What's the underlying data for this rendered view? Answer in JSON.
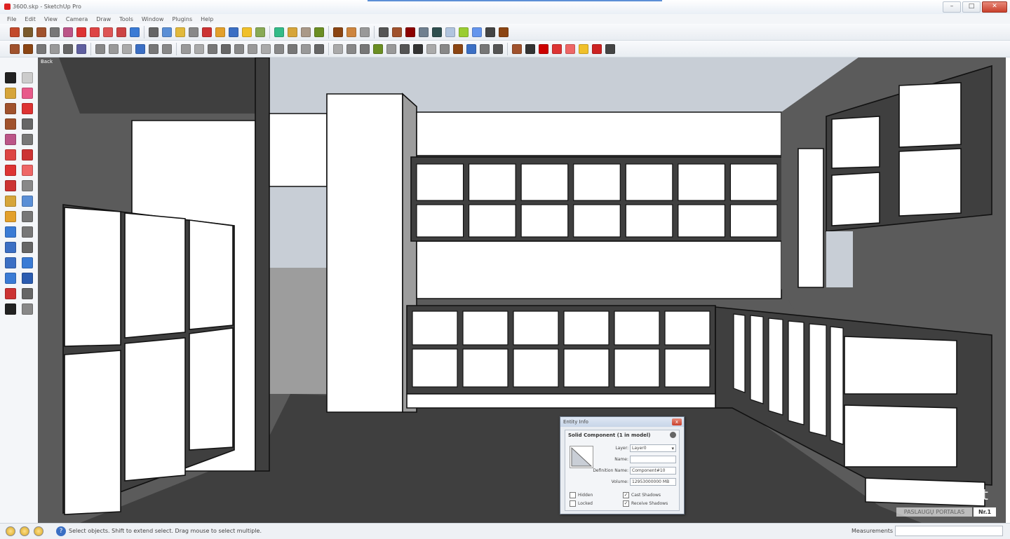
{
  "window": {
    "title": "3600.skp - SketchUp Pro",
    "controls": {
      "minimize": "–",
      "maximize": "□",
      "close": "✕"
    }
  },
  "menu": {
    "items": [
      "File",
      "Edit",
      "View",
      "Camera",
      "Draw",
      "Tools",
      "Window",
      "Plugins",
      "Help"
    ]
  },
  "toolbar_colors": {
    "row1": [
      "#c24a2c",
      "#7a5a2b",
      "#a0522d",
      "#777",
      "#b58",
      "#d33",
      "#d44",
      "#d55",
      "#c44",
      "#3a7bd5",
      "#666",
      "#5a8fd6",
      "#e2b93b",
      "#888",
      "#c33",
      "#e3a02b",
      "#3b6fc4",
      "#f0c02a",
      "#8a5",
      "#3b8",
      "#d6a53a",
      "#a98",
      "#6b8e23",
      "#8b4513",
      "#cd853f",
      "#999",
      "#555",
      "#a0522d",
      "#8b0000",
      "#708090",
      "#2f4f4f",
      "#b0c4de",
      "#9acd32",
      "#6495ed",
      "#444",
      "#8b4513"
    ],
    "row2": [
      "#a0522d",
      "#8b4513",
      "#777",
      "#999",
      "#666",
      "#5f5f9f",
      "#888",
      "#999",
      "#aaa",
      "#3b6fc4",
      "#777",
      "#888",
      "#999",
      "#aaa",
      "#777",
      "#666",
      "#888",
      "#999",
      "#aaa",
      "#888",
      "#777",
      "#999",
      "#666",
      "#aaa",
      "#888",
      "#777",
      "#6b8e23",
      "#999",
      "#555",
      "#333",
      "#aaa",
      "#888",
      "#8b4513",
      "#3b6fc4",
      "#777",
      "#555",
      "#a0522d",
      "#333",
      "#c00",
      "#d33",
      "#e66",
      "#f0c02a",
      "#c22",
      "#444"
    ]
  },
  "left_tool_colors": [
    "#222",
    "#ccc",
    "#d6a53a",
    "#e85a8a",
    "#a0522d",
    "#d33",
    "#a0522d",
    "#666",
    "#b58",
    "#777",
    "#d44",
    "#c33",
    "#d33",
    "#e66",
    "#c33",
    "#888",
    "#d6a53a",
    "#5a8fd6",
    "#e3a02b",
    "#777",
    "#3a7bd5",
    "#777",
    "#3b6fc4",
    "#666",
    "#3b6fc4",
    "#3a7bd5",
    "#3a7bd5",
    "#2b5cb0",
    "#c33",
    "#666",
    "#222",
    "#888"
  ],
  "viewport": {
    "scene_label": "Back",
    "palette": {
      "background": "#5b5b5b",
      "sky": "#c8ced6",
      "panel": "#ffffff",
      "edge": "#111111",
      "shadow": "#3f3f3f",
      "sideface": "#9d9d9d"
    }
  },
  "entity_info": {
    "title": "Entity Info",
    "close_label": "x",
    "heading": "Solid Component (1 in model)",
    "layer_label": "Layer:",
    "layer_value": "Layer0",
    "name_label": "Name:",
    "name_value": "",
    "definition_label": "Definition Name:",
    "definition_value": "Component#10",
    "volume_label": "Volume:",
    "volume_value": "12953000000 MB",
    "hidden_label": "Hidden",
    "locked_label": "Locked",
    "cast_shadows_label": "Cast Shadows",
    "receive_shadows_label": "Receive Shadows",
    "check_mark": "✓"
  },
  "status": {
    "help_glyph": "?",
    "text": "Select objects. Shift to extend select. Drag mouse to select multiple.",
    "measurements_label": "Measurements"
  },
  "watermark": {
    "text": "Paslaugos.lt",
    "subtitle": "PASLAUGŲ PORTALAS",
    "badge": "Nr.1"
  }
}
